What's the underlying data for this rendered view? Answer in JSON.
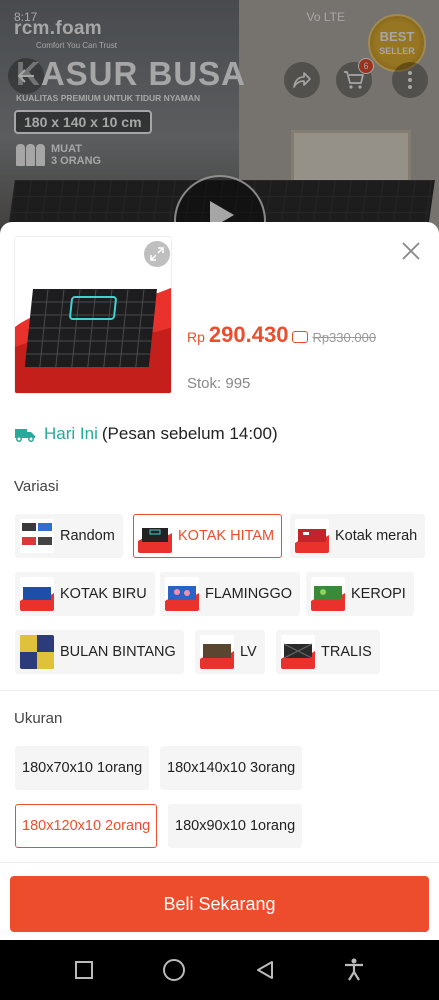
{
  "status_bar": {
    "time": "8:17",
    "network": "Vo LTE"
  },
  "banner": {
    "brand_name": "rcm.foam",
    "brand_tagline": "Comfort You Can Trust",
    "title": "KASUR BUSA",
    "subtitle": "KUALITAS PREMIUM UNTUK TIDUR NYAMAN",
    "size": "180 x 140 x 10 cm",
    "capacity_line1": "MUAT",
    "capacity_line2": "3 ORANG",
    "badge_line1": "BEST",
    "badge_line2": "SELLER",
    "cart_count": "6"
  },
  "product": {
    "price_currency": "Rp",
    "price": "290.430",
    "original_price": "Rp330.000",
    "stock_label": "Stok: 995"
  },
  "delivery": {
    "day": "Hari Ini",
    "note": "(Pesan sebelum 14:00)"
  },
  "variations": {
    "label": "Variasi",
    "items": [
      {
        "label": "Random",
        "selected": false
      },
      {
        "label": "KOTAK HITAM",
        "selected": true
      },
      {
        "label": "Kotak merah",
        "selected": false
      },
      {
        "label": "KOTAK BIRU",
        "selected": false
      },
      {
        "label": "FLAMINGGO",
        "selected": false
      },
      {
        "label": "KEROPI",
        "selected": false
      },
      {
        "label": "BULAN BINTANG",
        "selected": false
      },
      {
        "label": "LV",
        "selected": false
      },
      {
        "label": "TRALIS",
        "selected": false
      }
    ]
  },
  "sizes": {
    "label": "Ukuran",
    "items": [
      {
        "label": "180x70x10 1orang",
        "selected": false
      },
      {
        "label": "180x140x10 3orang",
        "selected": false
      },
      {
        "label": "180x120x10 2orang",
        "selected": true
      },
      {
        "label": "180x90x10 1orang",
        "selected": false
      }
    ]
  },
  "buy_button": "Beli Sekarang",
  "colors": {
    "accent": "#ee4d2d",
    "delivery_green": "#26aa99"
  }
}
